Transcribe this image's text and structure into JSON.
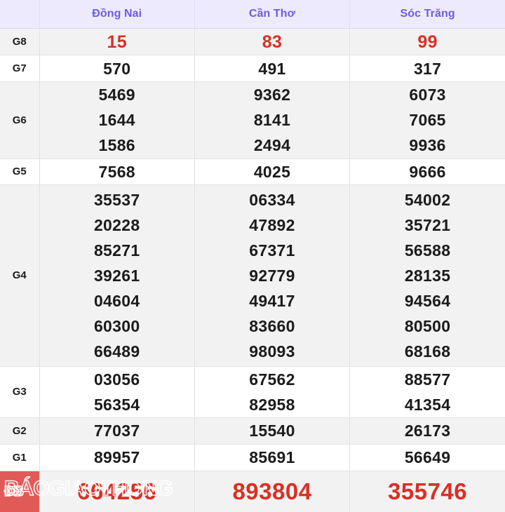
{
  "table": {
    "corner_label": "",
    "columns": [
      "Đồng Nai",
      "Cần Thơ",
      "Sóc Trăng"
    ],
    "colors": {
      "header_bg": "#eeeafd",
      "header_text": "#6c5ce7",
      "stripe_bg": "#f2f2f2",
      "row_bg": "#ffffff",
      "prize_red": "#d93025",
      "special_block": "#e05a57",
      "number_black": "#1b1b1b"
    },
    "rows": [
      {
        "label": "G8",
        "style": "red-sm",
        "values": [
          [
            "15"
          ],
          [
            "83"
          ],
          [
            "99"
          ]
        ]
      },
      {
        "label": "G7",
        "style": "black",
        "values": [
          [
            "570"
          ],
          [
            "491"
          ],
          [
            "317"
          ]
        ]
      },
      {
        "label": "G6",
        "style": "black",
        "values": [
          [
            "5469",
            "1644",
            "1586"
          ],
          [
            "9362",
            "8141",
            "2494"
          ],
          [
            "6073",
            "7065",
            "9936"
          ]
        ]
      },
      {
        "label": "G5",
        "style": "black",
        "values": [
          [
            "7568"
          ],
          [
            "4025"
          ],
          [
            "9666"
          ]
        ]
      },
      {
        "label": "G4",
        "style": "black",
        "values": [
          [
            "35537",
            "20228",
            "85271",
            "39261",
            "04604",
            "60300",
            "66489"
          ],
          [
            "06334",
            "47892",
            "67371",
            "92779",
            "49417",
            "83660",
            "98093"
          ],
          [
            "54002",
            "35721",
            "56588",
            "28135",
            "94564",
            "80500",
            "68168"
          ]
        ]
      },
      {
        "label": "G3",
        "style": "black",
        "values": [
          [
            "03056",
            "56354"
          ],
          [
            "67562",
            "82958"
          ],
          [
            "88577",
            "41354"
          ]
        ]
      },
      {
        "label": "G2",
        "style": "black",
        "values": [
          [
            "77037"
          ],
          [
            "15540"
          ],
          [
            "26173"
          ]
        ]
      },
      {
        "label": "G1",
        "style": "black",
        "values": [
          [
            "89957"
          ],
          [
            "85691"
          ],
          [
            "56649"
          ]
        ]
      },
      {
        "label": "ĐB",
        "style": "special",
        "values": [
          [
            "664256"
          ],
          [
            "893804"
          ],
          [
            "355746"
          ]
        ]
      }
    ]
  },
  "watermark": {
    "text": "BÁOGIAOTHONG"
  }
}
